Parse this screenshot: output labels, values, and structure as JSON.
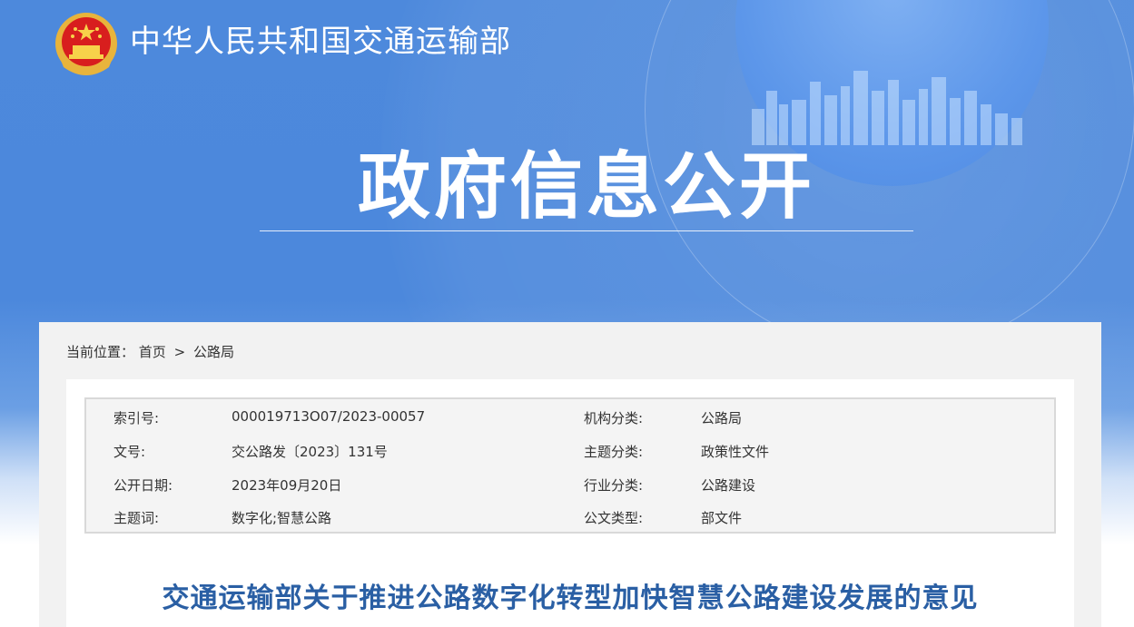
{
  "header": {
    "site_name": "中华人民共和国交通运输部",
    "headline": "政府信息公开"
  },
  "breadcrumb": {
    "label": "当前位置：",
    "items": [
      "首页",
      "公路局"
    ],
    "separator": ">"
  },
  "metadata": {
    "rows": [
      {
        "k1": "索引号:",
        "v1": "000019713O07/2023-00057",
        "k2": "机构分类:",
        "v2": "公路局"
      },
      {
        "k1": "文号:",
        "v1": "交公路发〔2023〕131号",
        "k2": "主题分类:",
        "v2": "政策性文件"
      },
      {
        "k1": "公开日期:",
        "v1": "2023年09月20日",
        "k2": "行业分类:",
        "v2": "公路建设"
      },
      {
        "k1": "主题词:",
        "v1": "数字化;智慧公路",
        "k2": "公文类型:",
        "v2": "部文件"
      }
    ]
  },
  "document": {
    "title": "交通运输部关于推进公路数字化转型加快智慧公路建设发展的意见"
  },
  "colors": {
    "banner_blue": "#4d89dc",
    "title_blue": "#2a5fa4",
    "content_bg": "#f2f2f2"
  }
}
